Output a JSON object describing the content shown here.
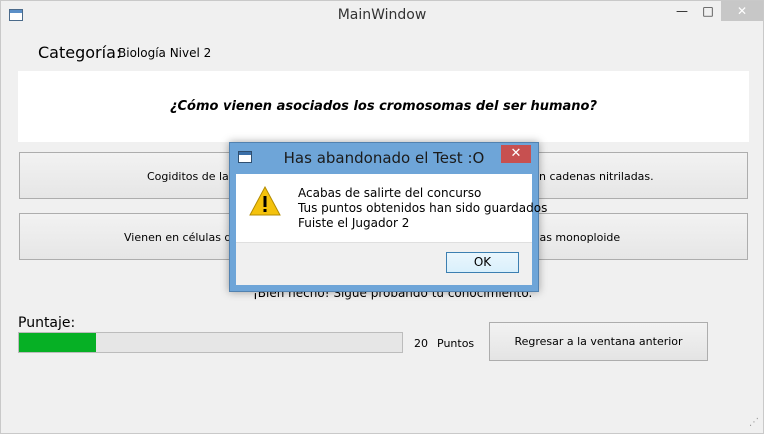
{
  "window": {
    "title": "MainWindow",
    "min_glyph": "—",
    "max_glyph": "□",
    "close_glyph": "✕"
  },
  "category": {
    "label": "Categoría:",
    "value": "Biología Nivel 2"
  },
  "question": {
    "text": "¿Cómo vienen asociados los cromosomas del ser humano?"
  },
  "answers": [
    {
      "label": "Cogiditos de la mano"
    },
    {
      "label": "Vienen unidos con cadenas nitriladas."
    },
    {
      "label": "Vienen en células diploides"
    },
    {
      "label": "Vienen en células monoploide"
    }
  ],
  "feedback": "¡Bien hecho! Sigue probando tu conocimiento.",
  "score": {
    "label": "Puntaje:",
    "value": "20",
    "unit": "Puntos",
    "progress_fraction": 0.2,
    "bar_color": "#06b025"
  },
  "back_button": "Regresar a la ventana anterior",
  "dialog": {
    "title": "Has abandonado el Test :O",
    "icon": "warning-icon",
    "lines": [
      "Acabas de salirte del concurso",
      "Tus puntos obtenidos han sido guardados",
      "Fuiste el Jugador 2"
    ],
    "ok_label": "OK",
    "close_glyph": "✕",
    "close_color": "#c75050"
  }
}
